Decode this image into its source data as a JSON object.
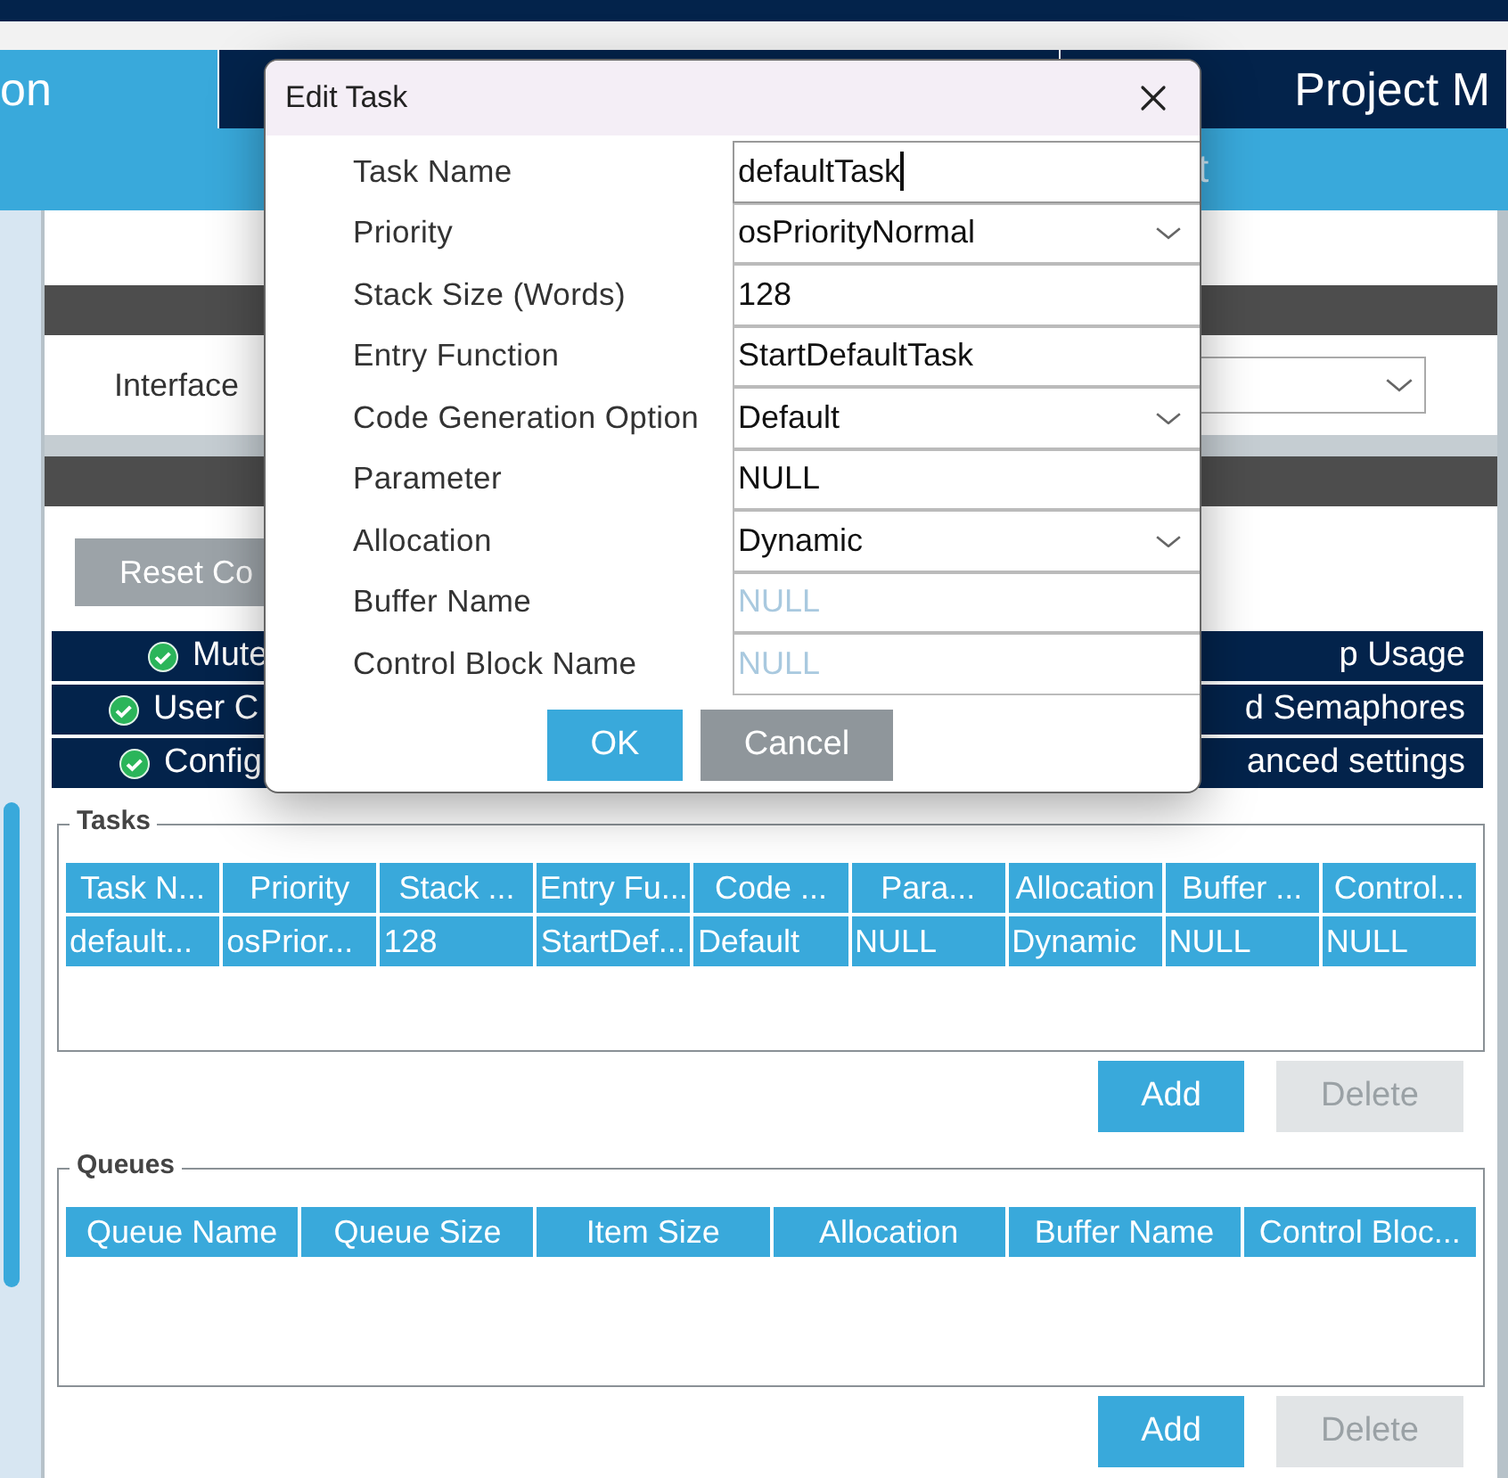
{
  "tabs": [
    {
      "label": "on",
      "selected": true
    },
    {
      "label": "Project M",
      "selected": false
    }
  ],
  "subtab": {
    "label": "t"
  },
  "interface": {
    "label": "Interface"
  },
  "reset_button": {
    "label": "Reset Co"
  },
  "feature_rows": [
    {
      "left": "Mute",
      "right": "p Usage"
    },
    {
      "left": "User C",
      "right": "d Semaphores"
    },
    {
      "left": "Config",
      "right": "anced settings"
    }
  ],
  "tasks": {
    "legend": "Tasks",
    "columns": [
      "Task N...",
      "Priority",
      "Stack ...",
      "Entry Fu...",
      "Code ...",
      "Para...",
      "Allocation",
      "Buffer ...",
      "Control..."
    ],
    "rows": [
      {
        "selected": true,
        "cells": [
          "default...",
          "osPrior...",
          "128",
          "StartDef...",
          "Default",
          "NULL",
          "Dynamic",
          "NULL",
          "NULL"
        ]
      }
    ],
    "buttons": [
      {
        "label": "Add",
        "disabled": false
      },
      {
        "label": "Delete",
        "disabled": true
      }
    ]
  },
  "queues": {
    "legend": "Queues",
    "columns": [
      "Queue Name",
      "Queue Size",
      "Item Size",
      "Allocation",
      "Buffer Name",
      "Control Bloc..."
    ],
    "buttons": [
      {
        "label": "Add",
        "disabled": false
      },
      {
        "label": "Delete",
        "disabled": true
      }
    ]
  },
  "dialog": {
    "title": "Edit Task",
    "fields": [
      {
        "label": "Task Name",
        "kind": "text",
        "value": "defaultTask",
        "focused": true
      },
      {
        "label": "Priority",
        "kind": "select",
        "value": "osPriorityNormal",
        "focused": false
      },
      {
        "label": "Stack Size (Words)",
        "kind": "text",
        "value": "128",
        "focused": false
      },
      {
        "label": "Entry Function",
        "kind": "text",
        "value": "StartDefaultTask",
        "focused": false
      },
      {
        "label": "Code Generation Option",
        "kind": "select",
        "value": "Default",
        "focused": false
      },
      {
        "label": "Parameter",
        "kind": "text",
        "value": "NULL",
        "focused": false
      },
      {
        "label": "Allocation",
        "kind": "select",
        "value": "Dynamic",
        "focused": false
      },
      {
        "label": "Buffer Name",
        "kind": "text",
        "placeholder": "NULL",
        "focused": false
      },
      {
        "label": "Control Block Name",
        "kind": "text",
        "placeholder": "NULL",
        "focused": false
      }
    ],
    "buttons": [
      {
        "label": "OK",
        "kind": "primary"
      },
      {
        "label": "Cancel",
        "kind": "secondary"
      }
    ]
  }
}
